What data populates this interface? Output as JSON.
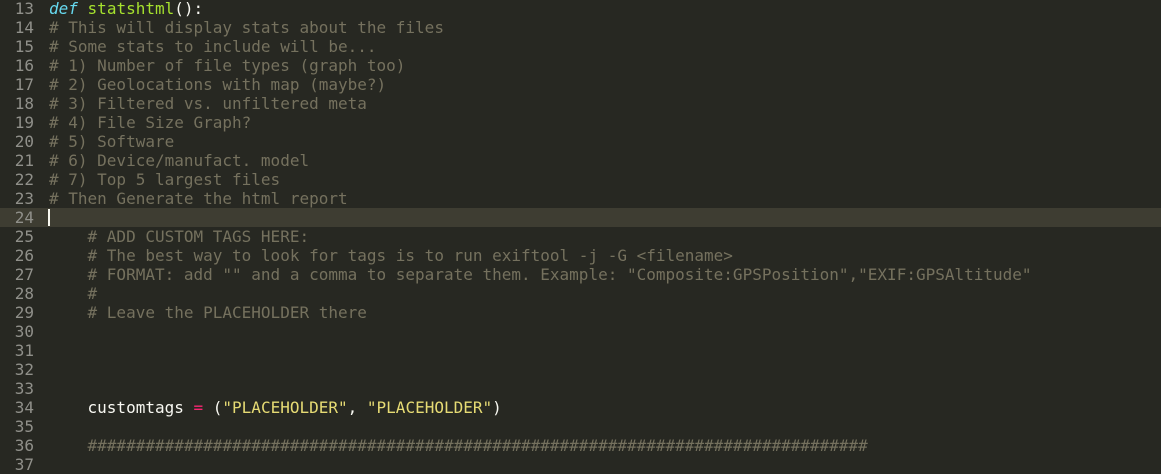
{
  "editor": {
    "active_line": 24,
    "lines": [
      {
        "num": "13",
        "tokens": [
          {
            "c": "keyword",
            "t": "def"
          },
          {
            "c": "plain",
            "t": " "
          },
          {
            "c": "func",
            "t": "statshtml"
          },
          {
            "c": "plain",
            "t": "():"
          }
        ]
      },
      {
        "num": "14",
        "tokens": [
          {
            "c": "comment",
            "t": "# This will display stats about the files"
          }
        ]
      },
      {
        "num": "15",
        "tokens": [
          {
            "c": "comment",
            "t": "# Some stats to include will be..."
          }
        ]
      },
      {
        "num": "16",
        "tokens": [
          {
            "c": "comment",
            "t": "# 1) Number of file types (graph too)"
          }
        ]
      },
      {
        "num": "17",
        "tokens": [
          {
            "c": "comment",
            "t": "# 2) Geolocations with map (maybe?)"
          }
        ]
      },
      {
        "num": "18",
        "tokens": [
          {
            "c": "comment",
            "t": "# 3) Filtered vs. unfiltered meta"
          }
        ]
      },
      {
        "num": "19",
        "tokens": [
          {
            "c": "comment",
            "t": "# 4) File Size Graph?"
          }
        ]
      },
      {
        "num": "20",
        "tokens": [
          {
            "c": "comment",
            "t": "# 5) Software"
          }
        ]
      },
      {
        "num": "21",
        "tokens": [
          {
            "c": "comment",
            "t": "# 6) Device/manufact. model"
          }
        ]
      },
      {
        "num": "22",
        "tokens": [
          {
            "c": "comment",
            "t": "# 7) Top 5 largest files"
          }
        ]
      },
      {
        "num": "23",
        "tokens": [
          {
            "c": "comment",
            "t": "# Then Generate the html report"
          }
        ]
      },
      {
        "num": "24",
        "tokens": []
      },
      {
        "num": "25",
        "tokens": [
          {
            "c": "plain",
            "t": "    "
          },
          {
            "c": "comment",
            "t": "# ADD CUSTOM TAGS HERE:"
          }
        ]
      },
      {
        "num": "26",
        "tokens": [
          {
            "c": "plain",
            "t": "    "
          },
          {
            "c": "comment",
            "t": "# The best way to look for tags is to run exiftool -j -G <filename>"
          }
        ]
      },
      {
        "num": "27",
        "tokens": [
          {
            "c": "plain",
            "t": "    "
          },
          {
            "c": "comment",
            "t": "# FORMAT: add \"\" and a comma to separate them. Example: \"Composite:GPSPosition\",\"EXIF:GPSAltitude\""
          }
        ]
      },
      {
        "num": "28",
        "tokens": [
          {
            "c": "plain",
            "t": "    "
          },
          {
            "c": "comment",
            "t": "#"
          }
        ]
      },
      {
        "num": "29",
        "tokens": [
          {
            "c": "plain",
            "t": "    "
          },
          {
            "c": "comment",
            "t": "# Leave the PLACEHOLDER there"
          }
        ]
      },
      {
        "num": "30",
        "tokens": []
      },
      {
        "num": "31",
        "tokens": []
      },
      {
        "num": "32",
        "tokens": []
      },
      {
        "num": "33",
        "tokens": []
      },
      {
        "num": "34",
        "tokens": [
          {
            "c": "plain",
            "t": "    customtags "
          },
          {
            "c": "op",
            "t": "="
          },
          {
            "c": "plain",
            "t": " ("
          },
          {
            "c": "str",
            "t": "\"PLACEHOLDER\""
          },
          {
            "c": "plain",
            "t": ", "
          },
          {
            "c": "str",
            "t": "\"PLACEHOLDER\""
          },
          {
            "c": "plain",
            "t": ")"
          }
        ]
      },
      {
        "num": "35",
        "tokens": []
      },
      {
        "num": "36",
        "tokens": [
          {
            "c": "plain",
            "t": "    "
          },
          {
            "c": "comment",
            "t": "#################################################################################"
          }
        ]
      },
      {
        "num": "37",
        "tokens": []
      }
    ]
  }
}
